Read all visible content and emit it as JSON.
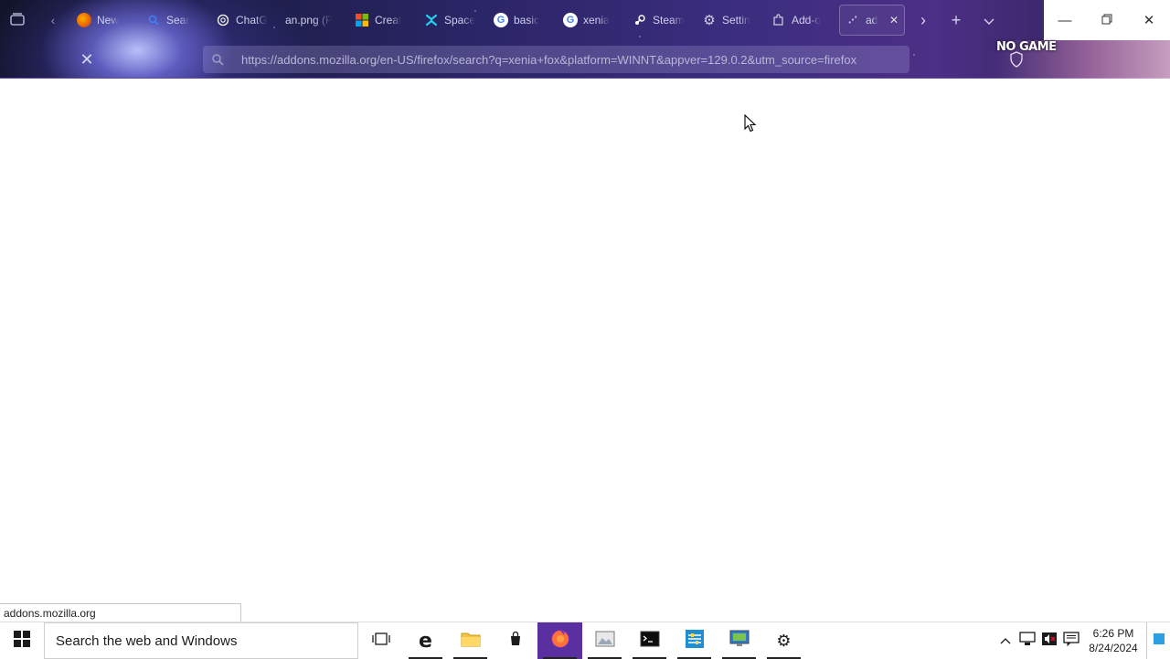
{
  "browser": {
    "tabs": [
      {
        "label": "New",
        "icon": "firefox-icon",
        "color": "#e66000"
      },
      {
        "label": "Sear",
        "icon": "search-icon",
        "color": "#3b82f6"
      },
      {
        "label": "ChatG",
        "icon": "chatgpt-icon",
        "color": "#ffffff"
      },
      {
        "label": "an.png (P",
        "icon": "",
        "color": ""
      },
      {
        "label": "Creat",
        "icon": "microsoft-icon",
        "color": "#f25022"
      },
      {
        "label": "Space",
        "icon": "space-icon",
        "color": "#22d3ee"
      },
      {
        "label": "basic",
        "icon": "google-icon",
        "color": "#ffffff"
      },
      {
        "label": "xenia",
        "icon": "google-icon",
        "color": "#ffffff"
      },
      {
        "label": "Steam",
        "icon": "steam-icon",
        "color": "#ffffff"
      },
      {
        "label": "Settin",
        "icon": "gear-icon",
        "color": "#cccccc"
      },
      {
        "label": "Add-o",
        "icon": "puzzle-icon",
        "color": "#cccccc"
      }
    ],
    "active_tab": {
      "label": "ad"
    },
    "url": "https://addons.mozilla.org/en-US/firefox/search?q=xenia+fox&platform=WINNT&appver=129.0.2&utm_source=firefox",
    "promo_text": "NO GAME",
    "status_url": "addons.mozilla.org"
  },
  "taskbar": {
    "search_placeholder": "Search the web and Windows",
    "time": "6:26 PM",
    "date": "8/24/2024"
  }
}
